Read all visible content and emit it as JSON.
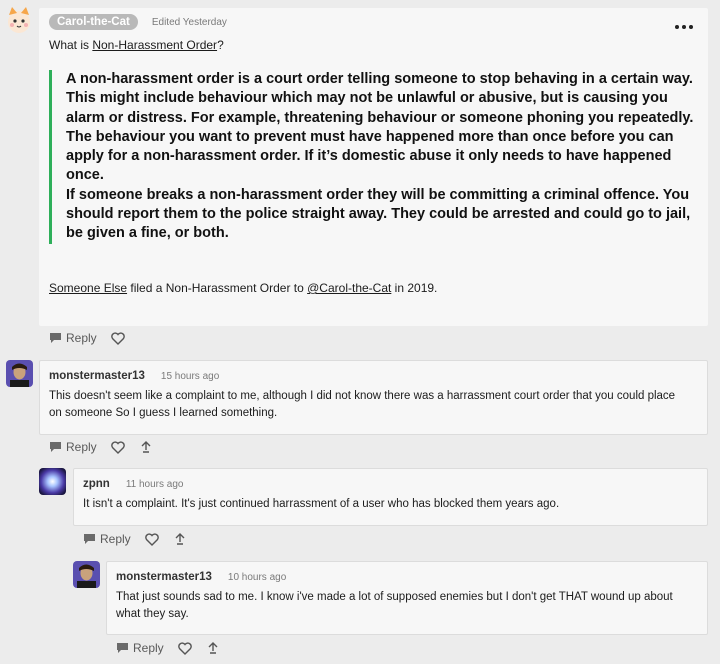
{
  "post": {
    "author": "Carol-the-Cat",
    "edited": "Edited Yesterday",
    "menu_icon": "more-horizontal-icon",
    "question_prefix": "What is ",
    "question_link": "Non-Harassment Order",
    "question_suffix": "?",
    "quote_lines": [
      "A non-harassment order is a court order telling someone to stop behaving in a certain way. This might include behaviour which may not be unlawful or abusive, but is causing you alarm or distress. For example, threatening behaviour or someone phoning you repeatedly.",
      "The behaviour you want to prevent must have happened more than once before you can apply for a non-harassment order. If it’s domestic abuse it only needs to have happened once.",
      "If someone breaks a non-harassment order they will be committing a criminal offence. You should report them to the police straight away. They could be arrested and could go to jail, be given a fine, or both."
    ],
    "footer_link1": "Someone Else",
    "footer_mid": " filed a Non-Harassment Order to ",
    "footer_link2": "@Carol-the-Cat",
    "footer_end": " in 2019.",
    "reply_label": "Reply"
  },
  "comments": [
    {
      "author": "monstermaster13",
      "time": "15 hours ago",
      "text": "This doesn't seem like a complaint to me, although I did not know there was a harrassment court order that you could place on someone  So I guess I learned something.",
      "reply_label": "Reply"
    },
    {
      "author": "zpnn",
      "time": "11 hours ago",
      "text": "It isn't a complaint. It's just continued harrassment of a user who has blocked them years ago.",
      "reply_label": "Reply"
    },
    {
      "author": "monstermaster13",
      "time": "10 hours ago",
      "text": "That just sounds sad to me. I know i've made a lot of supposed enemies but I don't get THAT wound up about what they say.",
      "reply_label": "Reply"
    }
  ],
  "colors": {
    "quote_bar": "#2eaf5a",
    "background": "#ececec",
    "card": "#f7f7f7"
  }
}
